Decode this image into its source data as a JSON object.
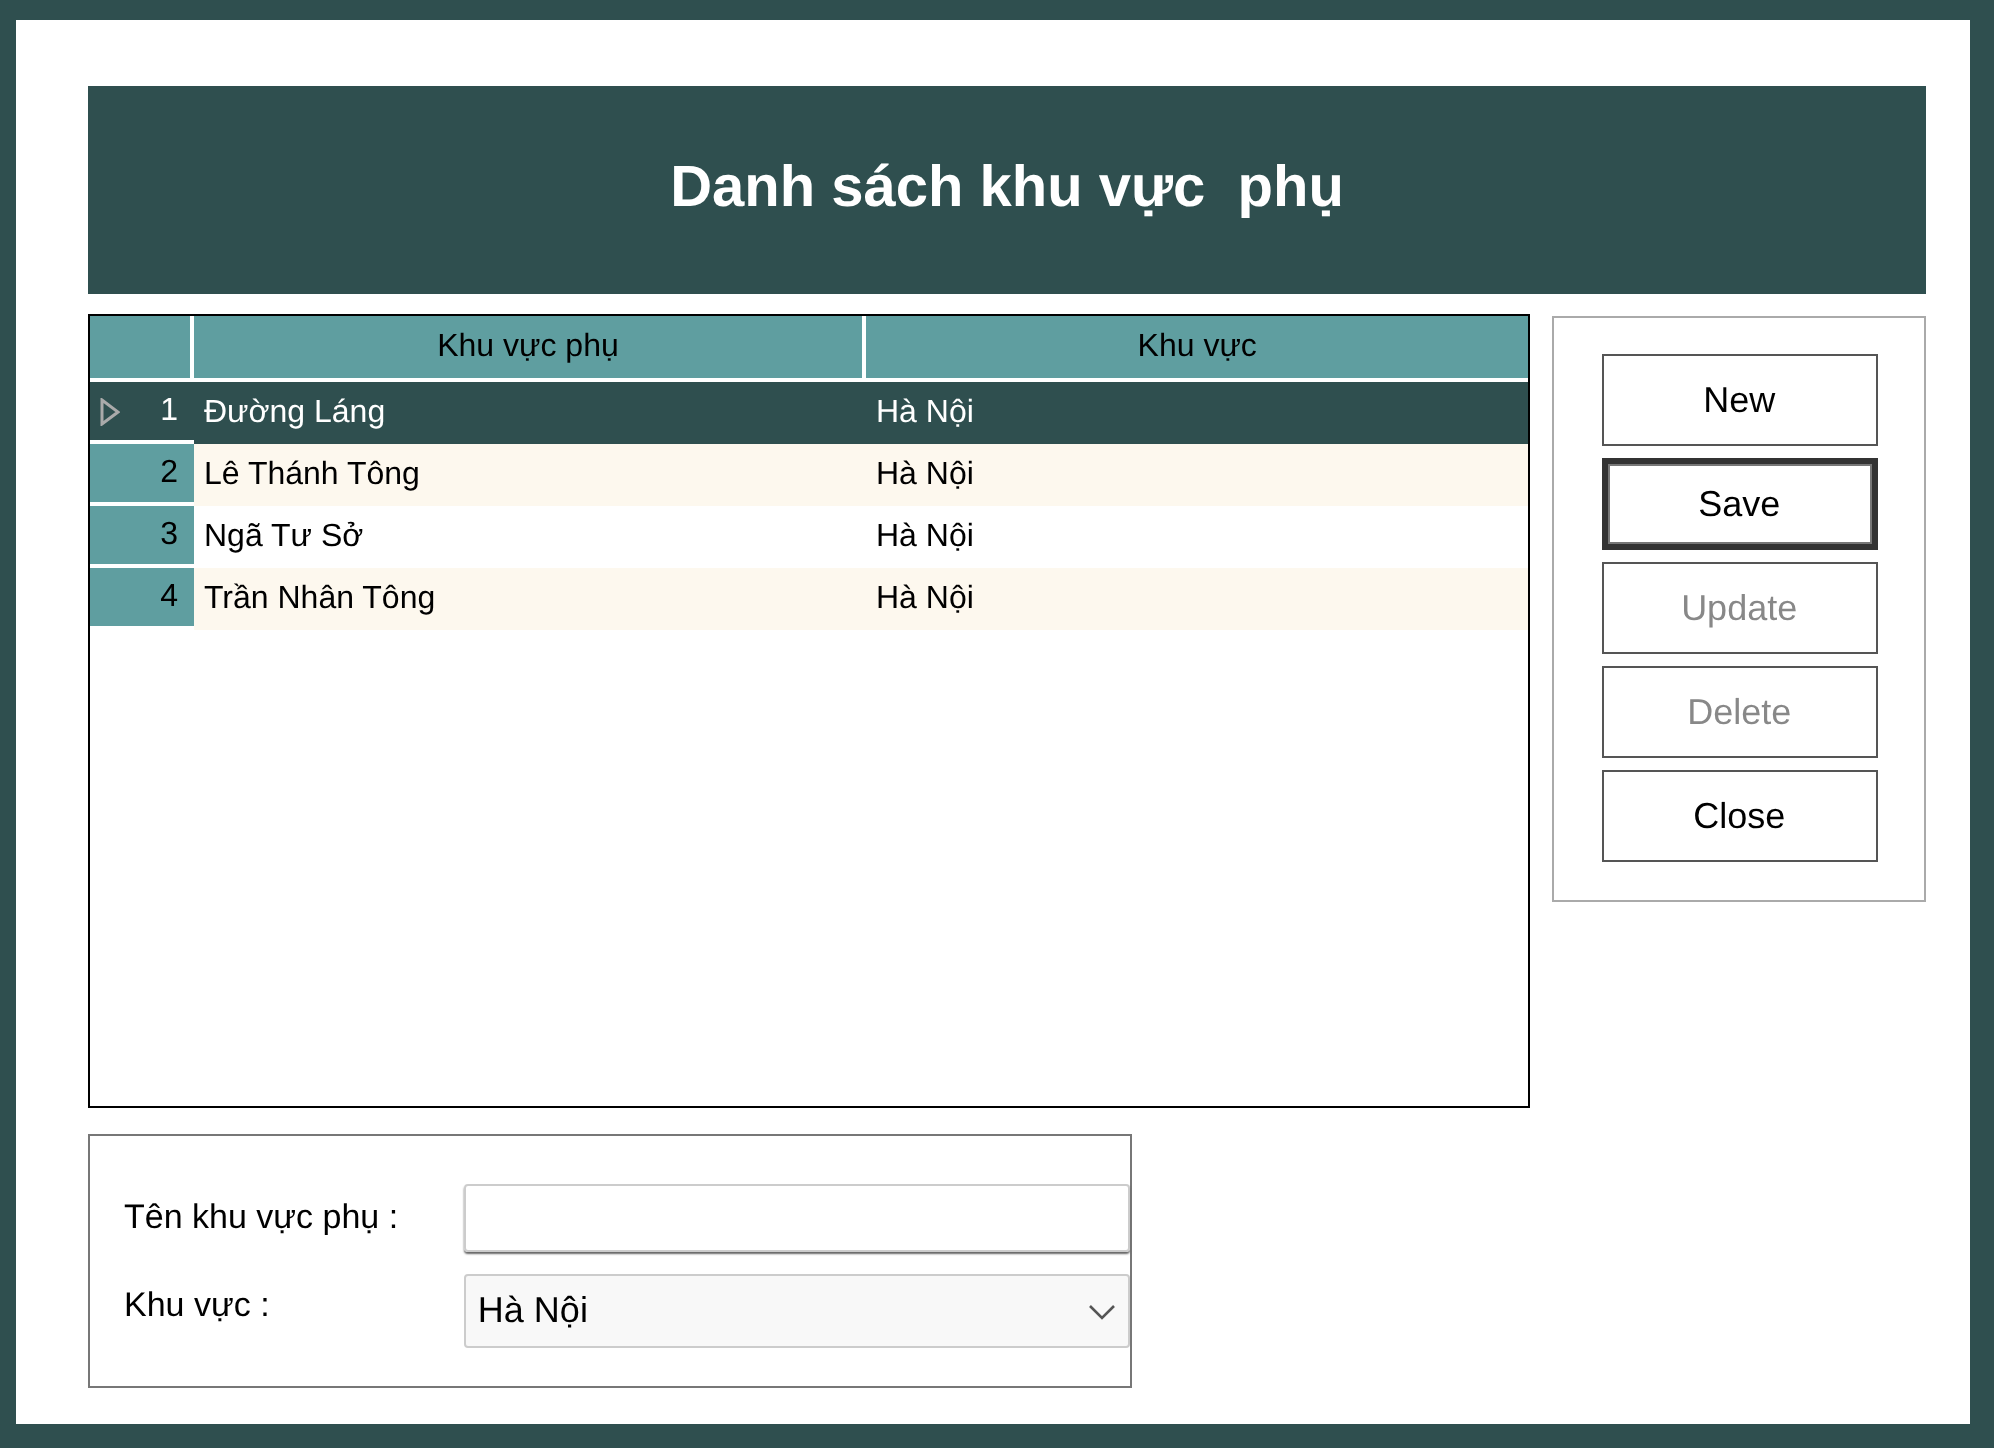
{
  "title": "Danh sách khu vực  phụ",
  "table": {
    "columns": [
      "Khu vực phụ",
      "Khu vực"
    ],
    "rows": [
      {
        "number": "1",
        "cells": [
          "Đường Láng",
          "Hà Nội"
        ],
        "selected": true
      },
      {
        "number": "2",
        "cells": [
          "Lê Thánh Tông",
          "Hà Nội"
        ],
        "selected": false
      },
      {
        "number": "3",
        "cells": [
          "Ngã Tư Sở",
          "Hà Nội"
        ],
        "selected": false
      },
      {
        "number": "4",
        "cells": [
          "Trần Nhân Tông",
          "Hà Nội"
        ],
        "selected": false
      }
    ]
  },
  "buttons": [
    {
      "label": "New",
      "disabled": false,
      "focused": false
    },
    {
      "label": "Save",
      "disabled": false,
      "focused": true
    },
    {
      "label": "Update",
      "disabled": true,
      "focused": false
    },
    {
      "label": "Delete",
      "disabled": true,
      "focused": false
    },
    {
      "label": "Close",
      "disabled": false,
      "focused": false
    }
  ],
  "form": {
    "name_label": "Tên khu vực phụ :",
    "region_label": "Khu vực :",
    "region_value": "Hà Nội"
  }
}
